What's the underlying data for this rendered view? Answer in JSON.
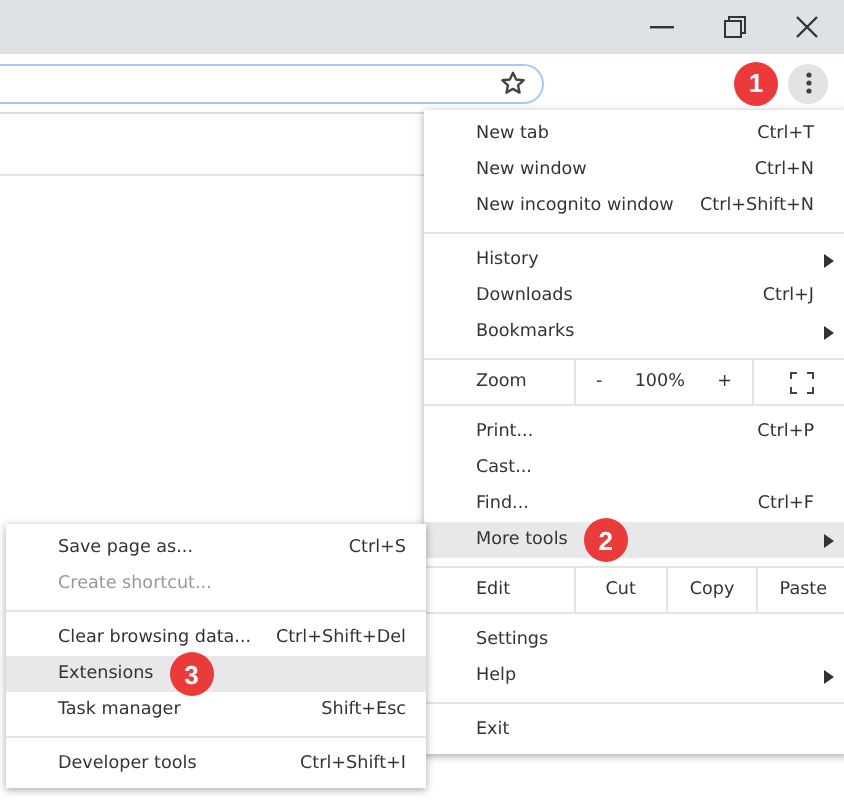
{
  "toolbar": {
    "badge": "1"
  },
  "menu": {
    "items": [
      {
        "kind": "item",
        "label": "New tab",
        "shortcut": "Ctrl+T",
        "submenu": false,
        "selected": false,
        "disabled": false
      },
      {
        "kind": "item",
        "label": "New window",
        "shortcut": "Ctrl+N",
        "submenu": false,
        "selected": false,
        "disabled": false
      },
      {
        "kind": "item",
        "label": "New incognito window",
        "shortcut": "Ctrl+Shift+N",
        "submenu": false,
        "selected": false,
        "disabled": false
      },
      {
        "kind": "separator"
      },
      {
        "kind": "item",
        "label": "History",
        "submenu": true,
        "selected": false,
        "disabled": false
      },
      {
        "kind": "item",
        "label": "Downloads",
        "shortcut": "Ctrl+J",
        "submenu": false,
        "selected": false,
        "disabled": false
      },
      {
        "kind": "item",
        "label": "Bookmarks",
        "submenu": true,
        "selected": false,
        "disabled": false
      },
      {
        "kind": "separator"
      },
      {
        "kind": "zoom",
        "label": "Zoom",
        "minus": "-",
        "value": "100%",
        "plus": "+"
      },
      {
        "kind": "separator"
      },
      {
        "kind": "item",
        "label": "Print...",
        "shortcut": "Ctrl+P",
        "submenu": false,
        "selected": false,
        "disabled": false
      },
      {
        "kind": "item",
        "label": "Cast...",
        "submenu": false,
        "selected": false,
        "disabled": false
      },
      {
        "kind": "item",
        "label": "Find...",
        "shortcut": "Ctrl+F",
        "submenu": false,
        "selected": false,
        "disabled": false
      },
      {
        "kind": "item",
        "label": "More tools",
        "submenu": true,
        "selected": true,
        "disabled": false,
        "badge": "2"
      },
      {
        "kind": "separator"
      },
      {
        "kind": "edit",
        "label": "Edit",
        "buttons": [
          "Cut",
          "Copy",
          "Paste"
        ]
      },
      {
        "kind": "separator"
      },
      {
        "kind": "item",
        "label": "Settings",
        "submenu": false,
        "selected": false,
        "disabled": false
      },
      {
        "kind": "item",
        "label": "Help",
        "submenu": true,
        "selected": false,
        "disabled": false
      },
      {
        "kind": "separator"
      },
      {
        "kind": "item",
        "label": "Exit",
        "submenu": false,
        "selected": false,
        "disabled": false
      }
    ]
  },
  "submenu": {
    "items": [
      {
        "kind": "item",
        "label": "Save page as...",
        "shortcut": "Ctrl+S",
        "selected": false,
        "disabled": false
      },
      {
        "kind": "item",
        "label": "Create shortcut...",
        "selected": false,
        "disabled": true
      },
      {
        "kind": "separator"
      },
      {
        "kind": "item",
        "label": "Clear browsing data...",
        "shortcut": "Ctrl+Shift+Del",
        "selected": false,
        "disabled": false
      },
      {
        "kind": "item",
        "label": "Extensions",
        "selected": true,
        "disabled": false,
        "badge": "3"
      },
      {
        "kind": "item",
        "label": "Task manager",
        "shortcut": "Shift+Esc",
        "selected": false,
        "disabled": false
      },
      {
        "kind": "separator"
      },
      {
        "kind": "item",
        "label": "Developer tools",
        "shortcut": "Ctrl+Shift+I",
        "selected": false,
        "disabled": false
      }
    ]
  }
}
